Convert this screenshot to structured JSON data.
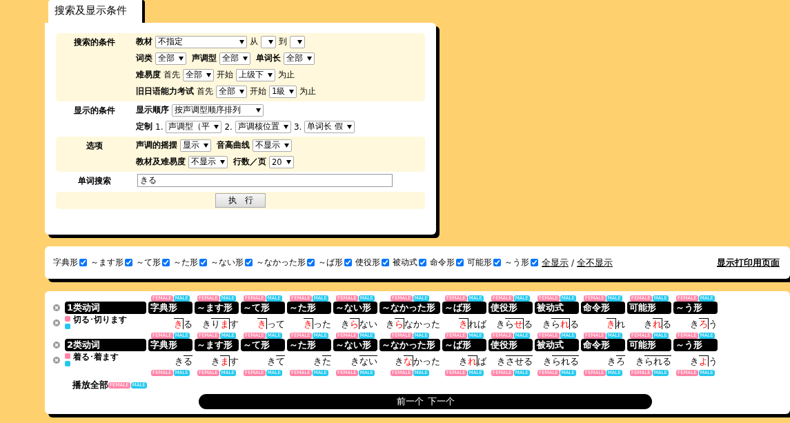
{
  "search_panel": {
    "tab": "搜索及显示条件",
    "sections": [
      {
        "title": "搜索的条件",
        "shaded": true,
        "lines": [
          [
            {
              "kind": "label",
              "text": "教材"
            },
            {
              "kind": "select",
              "value": "不指定",
              "wide": true
            },
            {
              "kind": "text",
              "text": "从"
            },
            {
              "kind": "select"
            },
            {
              "kind": "text",
              "text": "到"
            },
            {
              "kind": "select"
            }
          ],
          [
            {
              "kind": "label",
              "text": "词类"
            },
            {
              "kind": "select",
              "value": "全部"
            },
            {
              "kind": "label",
              "text": "声调型"
            },
            {
              "kind": "select",
              "value": "全部"
            },
            {
              "kind": "label",
              "text": "单词长"
            },
            {
              "kind": "select",
              "value": "全部"
            }
          ],
          [
            {
              "kind": "label",
              "text": "难易度"
            },
            {
              "kind": "text",
              "text": "首先"
            },
            {
              "kind": "select",
              "value": "全部"
            },
            {
              "kind": "text",
              "text": "开始"
            },
            {
              "kind": "select",
              "value": "上级下"
            },
            {
              "kind": "text",
              "text": "为止"
            }
          ],
          [
            {
              "kind": "label",
              "text": "旧日语能力考试"
            },
            {
              "kind": "text",
              "text": "首先"
            },
            {
              "kind": "select",
              "value": "全部"
            },
            {
              "kind": "text",
              "text": "开始"
            },
            {
              "kind": "select",
              "value": "1級"
            },
            {
              "kind": "text",
              "text": "为止"
            }
          ]
        ]
      },
      {
        "title": "显示的条件",
        "shaded": false,
        "lines": [
          [
            {
              "kind": "label",
              "text": "显示顺序"
            },
            {
              "kind": "select",
              "value": "按声调型顺序排列",
              "wide": true
            }
          ],
          [
            {
              "kind": "label",
              "text": "定制"
            },
            {
              "kind": "text",
              "text": "1."
            },
            {
              "kind": "select",
              "value": "声调型（平"
            },
            {
              "kind": "text",
              "text": "2."
            },
            {
              "kind": "select",
              "value": "声调核位置"
            },
            {
              "kind": "text",
              "text": "3."
            },
            {
              "kind": "select",
              "value": "单词长 假"
            }
          ]
        ]
      },
      {
        "title": "选项",
        "shaded": true,
        "lines": [
          [
            {
              "kind": "label",
              "text": "声调的摇摆"
            },
            {
              "kind": "select",
              "value": "显示"
            },
            {
              "kind": "label",
              "text": "音高曲线"
            },
            {
              "kind": "select",
              "value": "不显示"
            }
          ],
          [
            {
              "kind": "label",
              "text": "教材及难易度"
            },
            {
              "kind": "select",
              "value": "不显示"
            },
            {
              "kind": "label",
              "text": "行数／页"
            },
            {
              "kind": "select",
              "value": "20"
            }
          ]
        ]
      },
      {
        "title": "单词搜索",
        "shaded": false,
        "lines": [
          [
            {
              "kind": "input",
              "value": "きる"
            }
          ]
        ]
      }
    ],
    "submit": "执　行"
  },
  "filters": {
    "items": [
      {
        "label": "字典形",
        "checked": true
      },
      {
        "label": "～ます形",
        "checked": true
      },
      {
        "label": "～て形",
        "checked": true
      },
      {
        "label": "～た形",
        "checked": true
      },
      {
        "label": "～ない形",
        "checked": true
      },
      {
        "label": "～なかった形",
        "checked": true
      },
      {
        "label": "～ば形",
        "checked": true
      },
      {
        "label": "使役形",
        "checked": true
      },
      {
        "label": "被动式",
        "checked": true
      },
      {
        "label": "命令形",
        "checked": true
      },
      {
        "label": "可能形",
        "checked": true
      },
      {
        "label": "～う形",
        "checked": true
      }
    ],
    "show_all": "全显示",
    "separator": "/",
    "hide_all": "全不显示",
    "print": "显示打印用页面"
  },
  "groups": [
    {
      "label": "1类动词",
      "top_badges": [
        {
          "female": "FEMALE",
          "male": "MALE"
        },
        {
          "female": "FEMALE",
          "male": "MALE"
        },
        {
          "female": "FEMALE",
          "male": "MALE"
        },
        {
          "female": "FEMALE",
          "male": "MALE"
        },
        {
          "female": "FEMALE",
          "male": "MALE"
        },
        {
          "female": "FEMALE",
          "male": "MALE"
        },
        {
          "female": "FEMALE",
          "male": "MALE"
        },
        {
          "female": "FEMALE",
          "male": "MALE"
        },
        {
          "female": "FEMALE",
          "male": "MALE"
        },
        {
          "female": "FEMALE",
          "male": "MALE"
        },
        {
          "female": "FEMALE",
          "male": "MALE"
        },
        {
          "female": "FEMALE",
          "male": "MALE"
        }
      ],
      "columns": [
        "字典形",
        "～ます形",
        "～て形",
        "～た形",
        "～ない形",
        "～なかった形",
        "～ば形",
        "使役形",
        "被动式",
        "命令形",
        "可能形",
        "～う形"
      ],
      "words": [
        {
          "label": "切る･切ります",
          "forms": [
            {
              "female": "FEMALE",
              "male": "MALE",
              "mora": [
                {
                  "text": "き",
                  "kind": "drop"
                },
                {
                  "text": "る",
                  "kind": "low"
                }
              ]
            },
            {
              "female": "FEMALE",
              "male": "MALE",
              "mora": [
                {
                  "text": "き",
                  "kind": "low"
                },
                {
                  "text": "り",
                  "kind": "high"
                },
                {
                  "text": "ま",
                  "kind": "drop"
                },
                {
                  "text": "す",
                  "kind": "low"
                }
              ]
            },
            {
              "female": "FEMALE",
              "male": "MALE",
              "mora": [
                {
                  "text": "き",
                  "kind": "drop"
                },
                {
                  "text": "って",
                  "kind": "low"
                }
              ]
            },
            {
              "female": "FEMALE",
              "male": "MALE",
              "mora": [
                {
                  "text": "き",
                  "kind": "drop"
                },
                {
                  "text": "った",
                  "kind": "low"
                }
              ]
            },
            {
              "female": "FEMALE",
              "male": "MALE",
              "mora": [
                {
                  "text": "き",
                  "kind": "low"
                },
                {
                  "text": "ら",
                  "kind": "drop"
                },
                {
                  "text": "ない",
                  "kind": "low"
                }
              ]
            },
            {
              "female": "FEMALE",
              "male": "MALE",
              "mora": [
                {
                  "text": "き",
                  "kind": "low"
                },
                {
                  "text": "ら",
                  "kind": "drop"
                },
                {
                  "text": "なかった",
                  "kind": "low"
                }
              ]
            },
            {
              "female": "FEMALE",
              "male": "MALE",
              "mora": [
                {
                  "text": "き",
                  "kind": "drop"
                },
                {
                  "text": "れば",
                  "kind": "low"
                }
              ]
            },
            {
              "female": "FEMALE",
              "male": "MALE",
              "mora": [
                {
                  "text": "き",
                  "kind": "low"
                },
                {
                  "text": "ら",
                  "kind": "high"
                },
                {
                  "text": "せ",
                  "kind": "drop"
                },
                {
                  "text": "る",
                  "kind": "low"
                }
              ]
            },
            {
              "female": "FEMALE",
              "male": "MALE",
              "mora": [
                {
                  "text": "き",
                  "kind": "low"
                },
                {
                  "text": "ら",
                  "kind": "high"
                },
                {
                  "text": "れ",
                  "kind": "drop"
                },
                {
                  "text": "る",
                  "kind": "low"
                }
              ]
            },
            {
              "female": "FEMALE",
              "male": "MALE",
              "mora": [
                {
                  "text": "き",
                  "kind": "drop"
                },
                {
                  "text": "れ",
                  "kind": "low"
                }
              ]
            },
            {
              "female": "FEMALE",
              "male": "MALE",
              "mora": [
                {
                  "text": "き",
                  "kind": "low"
                },
                {
                  "text": "れ",
                  "kind": "drop"
                },
                {
                  "text": "る",
                  "kind": "low"
                }
              ]
            },
            {
              "female": "FEMALE",
              "male": "MALE",
              "mora": [
                {
                  "text": "き",
                  "kind": "low"
                },
                {
                  "text": "ろ",
                  "kind": "drop"
                },
                {
                  "text": "う",
                  "kind": "low"
                }
              ]
            }
          ]
        }
      ]
    },
    {
      "label": "2类动词",
      "columns": [
        "字典形",
        "～ます形",
        "～て形",
        "～た形",
        "～ない形",
        "～なかった形",
        "～ば形",
        "使役形",
        "被动式",
        "命令形",
        "可能形",
        "～う形"
      ],
      "words": [
        {
          "label": "着る･着ます",
          "forms": [
            {
              "female": "FEMALE",
              "male": "MALE",
              "mora": [
                {
                  "text": "き",
                  "kind": "low"
                },
                {
                  "text": "る",
                  "kind": "high"
                }
              ]
            },
            {
              "female": "FEMALE",
              "male": "MALE",
              "mora": [
                {
                  "text": "き",
                  "kind": "low"
                },
                {
                  "text": "ま",
                  "kind": "drop"
                },
                {
                  "text": "す",
                  "kind": "low"
                }
              ]
            },
            {
              "female": "FEMALE",
              "male": "MALE",
              "mora": [
                {
                  "text": "き",
                  "kind": "low"
                },
                {
                  "text": "て",
                  "kind": "high"
                }
              ]
            },
            {
              "female": "FEMALE",
              "male": "MALE",
              "mora": [
                {
                  "text": "き",
                  "kind": "low"
                },
                {
                  "text": "た",
                  "kind": "high"
                }
              ]
            },
            {
              "female": "FEMALE",
              "male": "MALE",
              "mora": [
                {
                  "text": "き",
                  "kind": "low"
                },
                {
                  "text": "ない",
                  "kind": "high"
                }
              ]
            },
            {
              "female": "FEMALE",
              "male": "MALE",
              "mora": [
                {
                  "text": "き",
                  "kind": "low"
                },
                {
                  "text": "な",
                  "kind": "drop"
                },
                {
                  "text": "かった",
                  "kind": "low"
                }
              ]
            },
            {
              "female": "FEMALE",
              "male": "MALE",
              "mora": [
                {
                  "text": "き",
                  "kind": "low"
                },
                {
                  "text": "れ",
                  "kind": "drop"
                },
                {
                  "text": "ば",
                  "kind": "low"
                }
              ]
            },
            {
              "female": "FEMALE",
              "male": "MALE",
              "mora": [
                {
                  "text": "き",
                  "kind": "low"
                },
                {
                  "text": "させる",
                  "kind": "high"
                }
              ]
            },
            {
              "female": "FEMALE",
              "male": "MALE",
              "mora": [
                {
                  "text": "き",
                  "kind": "low"
                },
                {
                  "text": "られる",
                  "kind": "high"
                }
              ]
            },
            {
              "female": "FEMALE",
              "male": "MALE",
              "mora": [
                {
                  "text": "き",
                  "kind": "low"
                },
                {
                  "text": "ろ",
                  "kind": "high"
                }
              ]
            },
            {
              "female": "FEMALE",
              "male": "MALE",
              "mora": [
                {
                  "text": "き",
                  "kind": "low"
                },
                {
                  "text": "られる",
                  "kind": "high"
                }
              ]
            },
            {
              "female": "FEMALE",
              "male": "MALE",
              "mora": [
                {
                  "text": "き",
                  "kind": "low"
                },
                {
                  "text": "よ",
                  "kind": "drop"
                },
                {
                  "text": "う",
                  "kind": "low"
                }
              ]
            }
          ]
        }
      ]
    }
  ],
  "play_all": {
    "label": "播放全部",
    "female": "FEMALE",
    "male": "MALE"
  },
  "pager": {
    "prev": "前一个",
    "next": "下一个"
  }
}
